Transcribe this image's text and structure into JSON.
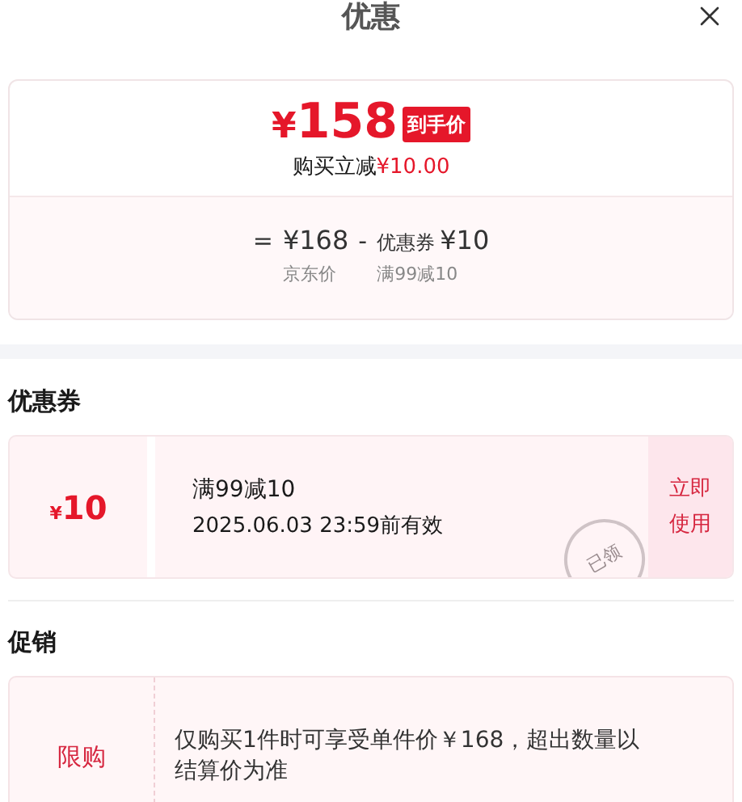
{
  "title": "优惠",
  "price_summary": {
    "currency": "¥",
    "final_price": "158",
    "badge": "到手价",
    "saving_label": "购买立减",
    "saving_amount": "¥10.00",
    "equals": "=",
    "base_price": "¥168",
    "base_label": "京东价",
    "minus": "-",
    "coupon_label": "优惠券",
    "coupon_value": "¥10",
    "coupon_condition": "满99减10"
  },
  "coupon_section": {
    "heading": "优惠券",
    "coupons": [
      {
        "currency": "¥",
        "amount": "10",
        "title": "满99减10",
        "validity": "2025.06.03 23:59前有效",
        "claimed": true,
        "stamp": "已领",
        "action": "立即使用"
      }
    ]
  },
  "promotion_section": {
    "heading": "促销",
    "promotions": [
      {
        "tag": "限购",
        "description": "仅购买1件时可享受单件价￥168，超出数量以结算价为准"
      }
    ]
  }
}
